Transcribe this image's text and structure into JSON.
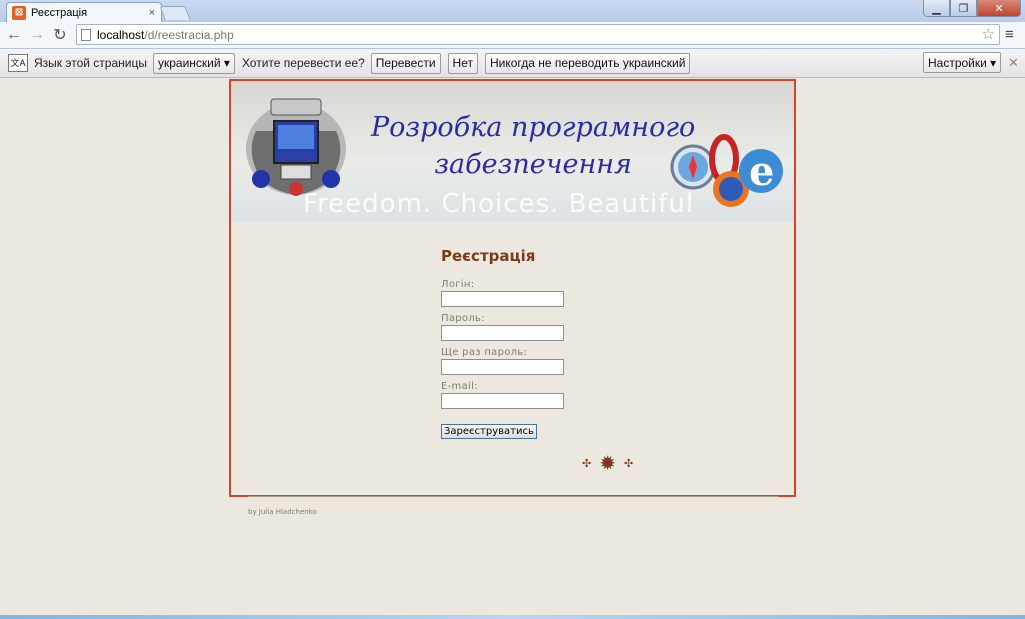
{
  "browser": {
    "tab_title": "Реєстрація",
    "tab_close": "×",
    "url_host": "localhost",
    "url_path": "/d/reestracia.php"
  },
  "translate_bar": {
    "prompt": "Язык этой страницы",
    "language_selected": "украинский",
    "question": "Хотите перевести ее?",
    "translate_button": "Перевести",
    "no_button": "Нет",
    "never_button": "Никогда не переводить украинский",
    "settings_button": "Настройки"
  },
  "banner": {
    "title_line1": "Розробка програмного",
    "title_line2": "забезпечення",
    "tagline": "Freedom. Choices. Beautiful"
  },
  "form": {
    "heading": "Реєстрація",
    "login_label": "Логін:",
    "password_label": "Пароль:",
    "password_repeat_label": "Ще раз пароль:",
    "email_label": "E-mail:",
    "submit_label": "Зареєструватись"
  },
  "footer": {
    "credit": "by Julia Hladchenko"
  },
  "colors": {
    "accent_border": "#d2452f",
    "heading": "#7a3b1a",
    "banner_title": "#2b2ba8"
  }
}
